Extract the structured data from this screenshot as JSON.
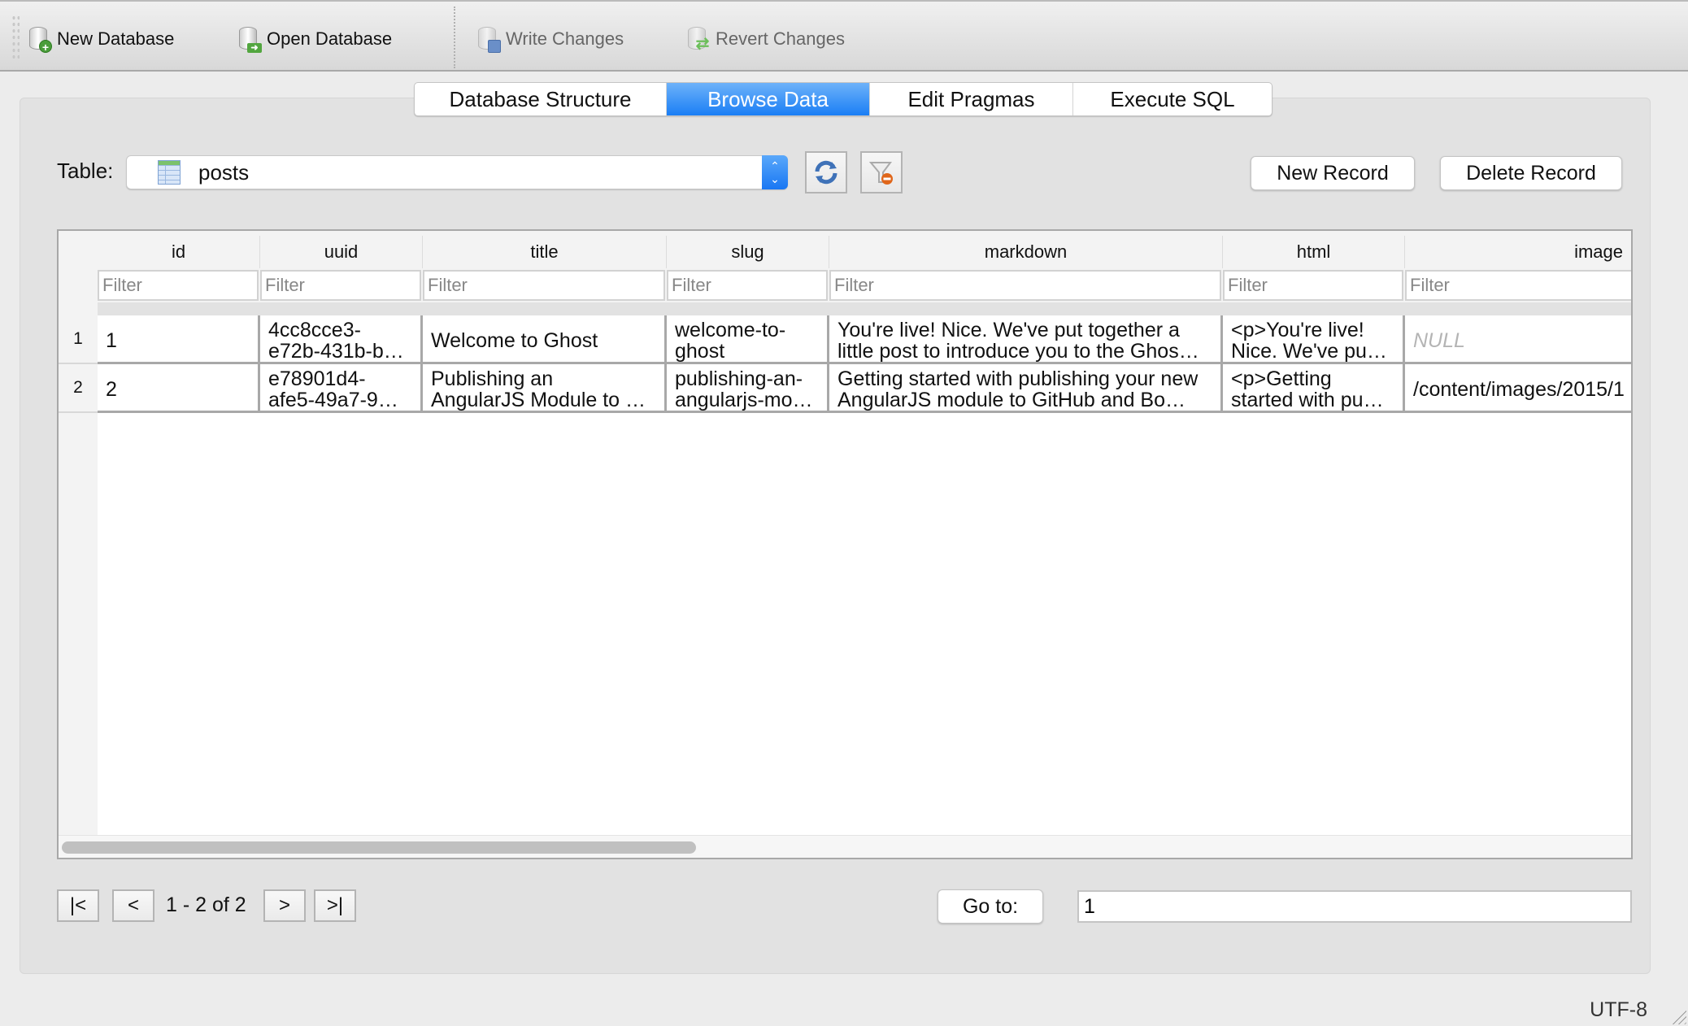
{
  "toolbar": {
    "new_database": "New Database",
    "open_database": "Open Database",
    "write_changes": "Write Changes",
    "revert_changes": "Revert Changes"
  },
  "tabs": [
    {
      "label": "Database Structure",
      "active": false
    },
    {
      "label": "Browse Data",
      "active": true
    },
    {
      "label": "Edit Pragmas",
      "active": false
    },
    {
      "label": "Execute SQL",
      "active": false
    }
  ],
  "browse": {
    "table_label": "Table:",
    "table_selected": "posts",
    "refresh_icon": "refresh-icon",
    "clear_filters_icon": "clear-filter-icon",
    "new_record": "New Record",
    "delete_record": "Delete Record"
  },
  "grid": {
    "columns": [
      "id",
      "uuid",
      "title",
      "slug",
      "markdown",
      "html",
      "image"
    ],
    "filter_placeholder": "Filter",
    "rows": [
      {
        "rownum": "1",
        "cells": [
          "1",
          "4cc8cce3-\ne72b-431b-b…",
          "Welcome to Ghost",
          "welcome-to-\nghost",
          "You're live! Nice. We've put together a\nlittle post to introduce you to the Ghos…",
          "<p>You're live!\nNice. We've pu…",
          "NULL"
        ]
      },
      {
        "rownum": "2",
        "cells": [
          "2",
          "e78901d4-\nafe5-49a7-9…",
          "Publishing an\nAngularJS Module to …",
          "publishing-an-\nangularjs-mo…",
          "Getting started with publishing your new\nAngularJS module to GitHub and Bo…",
          "<p>Getting\nstarted with pu…",
          "/content/images/2015/1"
        ]
      }
    ]
  },
  "pagination": {
    "first": "|<",
    "prev": "<",
    "range": "1 - 2 of 2",
    "next": ">",
    "last": ">|",
    "goto_label": "Go to:",
    "goto_value": "1"
  },
  "status": {
    "encoding": "UTF-8"
  },
  "colors": {
    "accent": "#1a7ef5",
    "null_text": "#b4b4b4"
  }
}
